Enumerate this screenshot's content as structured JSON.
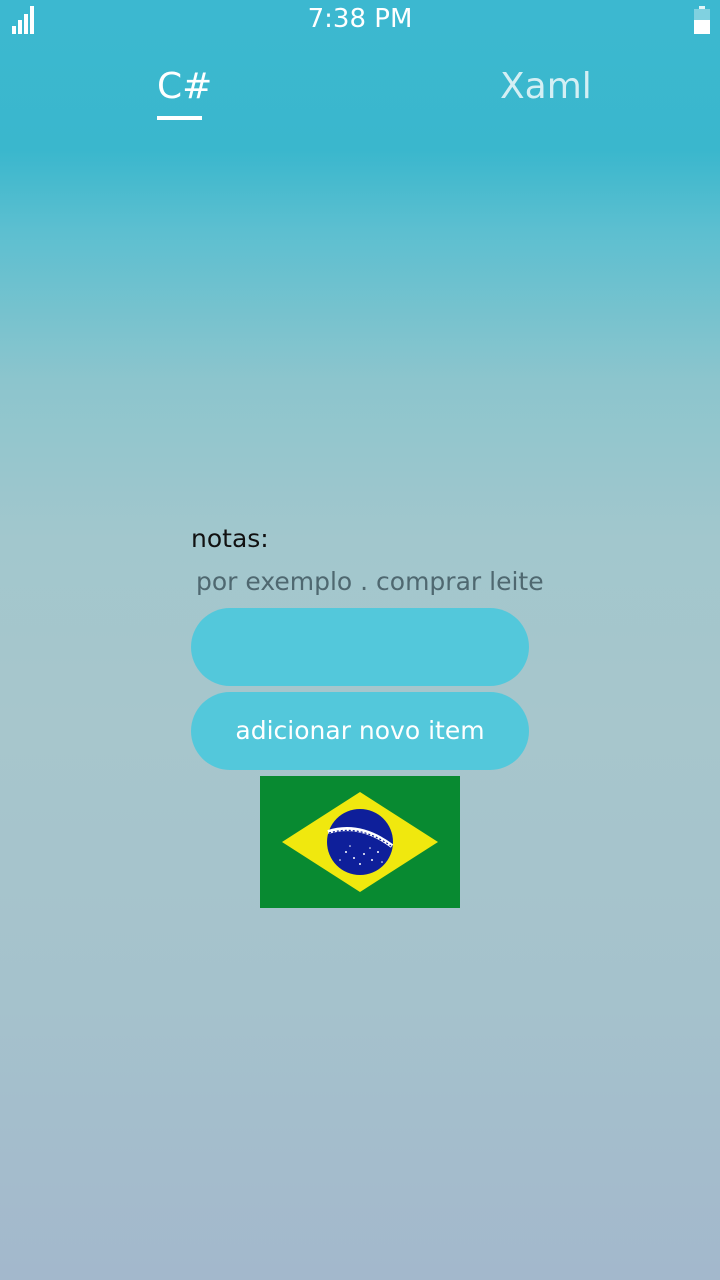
{
  "status_bar": {
    "time": "7:38 PM",
    "signal_icon": "signal-strength-icon",
    "battery_icon": "battery-icon",
    "battery_level": 0.55
  },
  "tabs": [
    {
      "label": "C#",
      "selected": true
    },
    {
      "label": "Xaml",
      "selected": false
    }
  ],
  "form": {
    "label": "notas:",
    "hint": "por exemplo . comprar leite",
    "input_value": "",
    "add_button_label": "adicionar novo item"
  },
  "image": {
    "icon": "brazil-flag-image"
  },
  "colors": {
    "accent": "#53c8db",
    "header": "#3ab7cd",
    "flag_green": "#088a31",
    "flag_yellow": "#f0e80e",
    "flag_blue": "#0e1f9a"
  }
}
